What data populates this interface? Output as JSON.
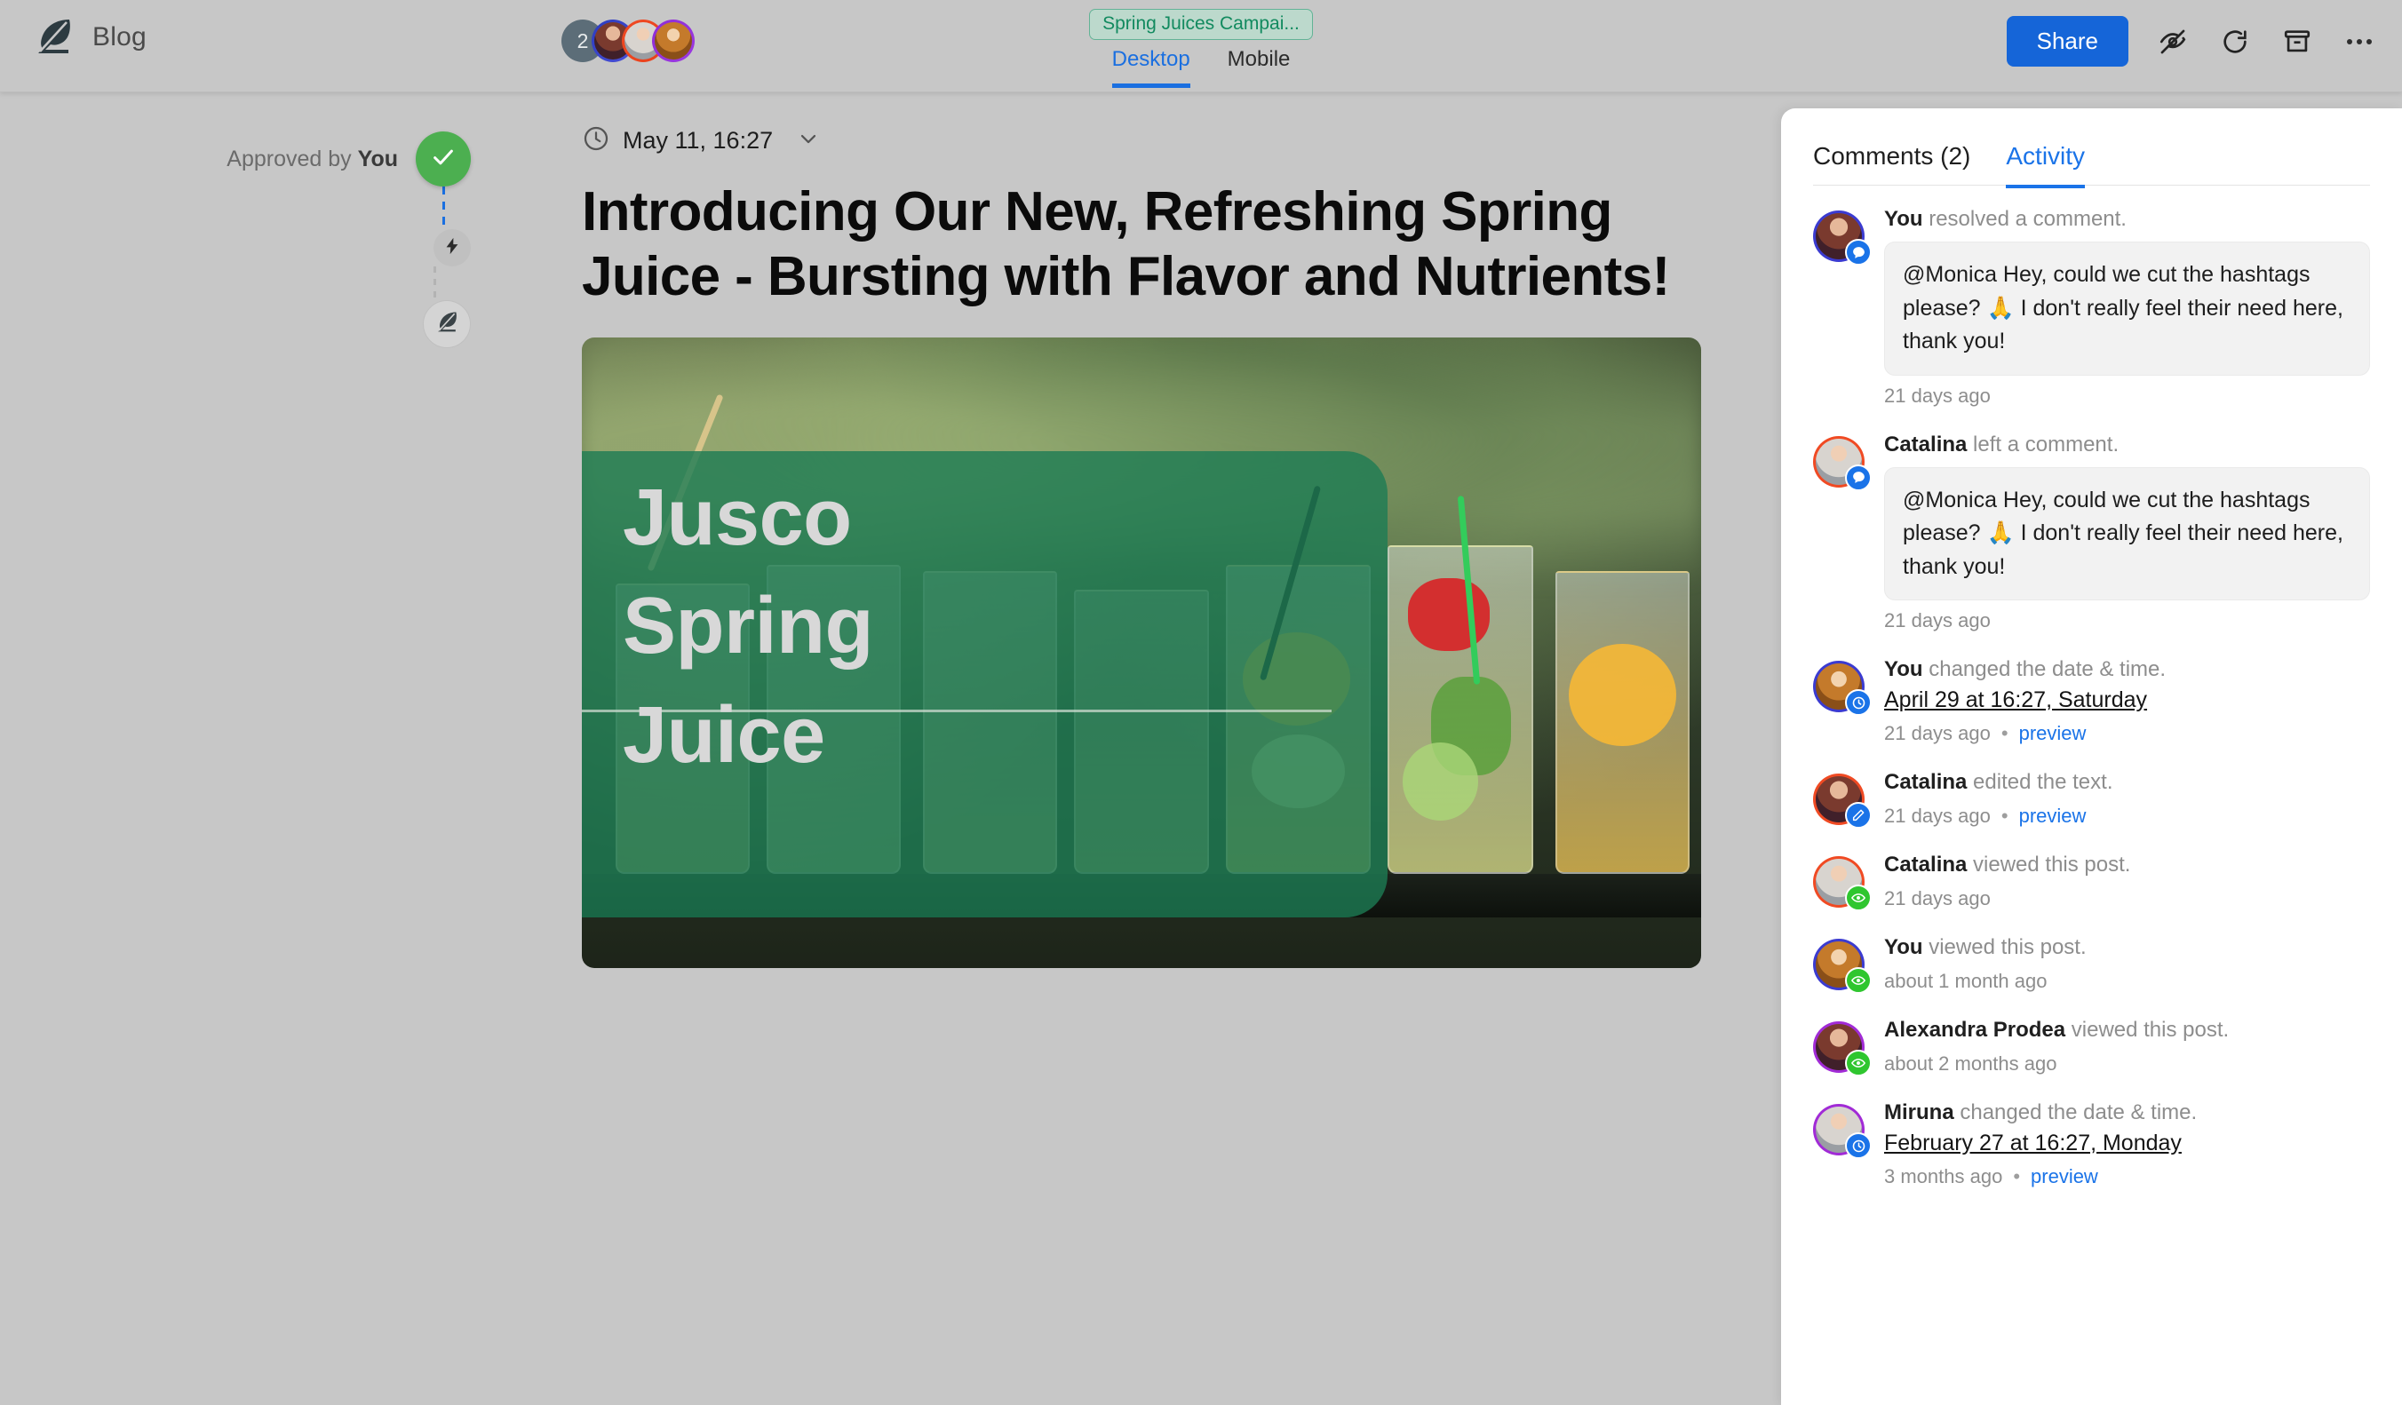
{
  "header": {
    "logo_icon": "feather-logo",
    "brand_title": "Blog",
    "avatar_count": "2",
    "campaign_chip": "Spring Juices Campai...",
    "tabs": [
      {
        "label": "Desktop",
        "active": true
      },
      {
        "label": "Mobile",
        "active": false
      }
    ],
    "share_label": "Share",
    "icons": [
      "eye-off-icon",
      "refresh-icon",
      "archive-icon",
      "more-options-icon"
    ],
    "accent_blue": "#1565d8",
    "chip_text_color": "#128a5f",
    "chip_bg_color": "#bcd9cc"
  },
  "approval_rail": {
    "label_prefix": "Approved by ",
    "label_actor": "You",
    "nodes": [
      {
        "name": "approved-check",
        "icon": "check-icon",
        "color": "#4caf50"
      },
      {
        "name": "automation",
        "icon": "lightning-icon",
        "color": "#c0c0c0"
      },
      {
        "name": "draft",
        "icon": "feather-icon",
        "color": "#d4d4d4"
      }
    ]
  },
  "post": {
    "date_icon": "clock-icon",
    "date": "May 11, 16:27",
    "date_chevron": "chevron-down-icon",
    "title": "Introducing Our New, Refreshing Spring Juice - Bursting with Flavor and Nutrients!",
    "image": {
      "overlay_line1": "Jusco",
      "overlay_line2": "Spring",
      "overlay_line3": "Juice",
      "overlay_color": "#1d7c54",
      "alt": "Mason jars with fruit infused spring juice"
    }
  },
  "panel": {
    "tabs": [
      {
        "label": "Comments (2)",
        "active": false
      },
      {
        "label": "Activity",
        "active": true
      }
    ],
    "activity": [
      {
        "actor": "You",
        "action": " resolved a comment.",
        "badge": "comment-badge",
        "badge_color": "#1a73e8",
        "avatar_ring": "#3b3bd0",
        "comment": "@Monica Hey, could we cut the hashtags please? 🙏 I don't really feel their need here, thank you!",
        "time": "21 days ago",
        "preview": null,
        "link": null
      },
      {
        "actor": "Catalina",
        "action": " left a comment.",
        "badge": "comment-badge",
        "badge_color": "#1a73e8",
        "avatar_ring": "#f04a23",
        "comment": "@Monica Hey, could we cut the hashtags please? 🙏 I don't really feel their need here, thank you!",
        "time": "21 days ago",
        "preview": null,
        "link": null
      },
      {
        "actor": "You",
        "action": " changed the date & time.",
        "badge": "clock-badge",
        "badge_color": "#1a73e8",
        "avatar_ring": "#3b3bd0",
        "comment": null,
        "link": "April 29 at 16:27, Saturday",
        "time": "21 days ago",
        "preview": "preview"
      },
      {
        "actor": "Catalina",
        "action": " edited the text.",
        "badge": "pencil-badge",
        "badge_color": "#1a73e8",
        "avatar_ring": "#f04a23",
        "comment": null,
        "link": null,
        "time": "21 days ago",
        "preview": "preview"
      },
      {
        "actor": "Catalina",
        "action": " viewed this post.",
        "badge": "eye-badge",
        "badge_color": "#2fc62f",
        "avatar_ring": "#f04a23",
        "comment": null,
        "link": null,
        "time": "21 days ago",
        "preview": null
      },
      {
        "actor": "You",
        "action": " viewed this post.",
        "badge": "eye-badge",
        "badge_color": "#2fc62f",
        "avatar_ring": "#3b3bd0",
        "comment": null,
        "link": null,
        "time": "about 1 month ago",
        "preview": null
      },
      {
        "actor": "Alexandra Prodea",
        "action": " viewed this post.",
        "badge": "eye-badge",
        "badge_color": "#2fc62f",
        "avatar_ring": "#a12bd6",
        "comment": null,
        "link": null,
        "time": "about 2 months ago",
        "preview": null
      },
      {
        "actor": "Miruna",
        "action": " changed the date & time.",
        "badge": "clock-badge",
        "badge_color": "#1a73e8",
        "avatar_ring": "#a12bd6",
        "comment": null,
        "link": "February 27 at 16:27, Monday",
        "time": "3 months ago",
        "preview": "preview"
      }
    ],
    "separator_dot": "•"
  }
}
